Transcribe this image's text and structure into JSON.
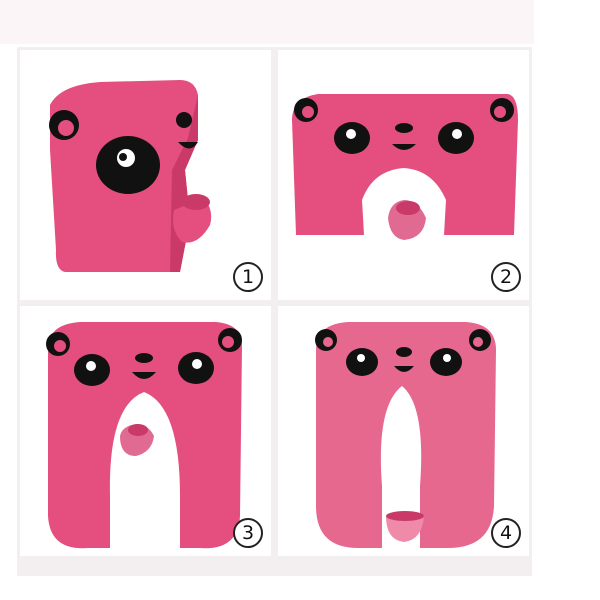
{
  "steps": [
    {
      "number": "1",
      "art": "folded-seat-with-cup"
    },
    {
      "number": "2",
      "art": "half-open-seat-with-cup"
    },
    {
      "number": "3",
      "art": "open-seat-with-cup"
    },
    {
      "number": "4",
      "art": "open-seat-cup-attached"
    }
  ],
  "colors": {
    "seat": "#e44f80",
    "seat_dark": "#c93a69",
    "face": "#111111",
    "background": "#f3eff1"
  }
}
